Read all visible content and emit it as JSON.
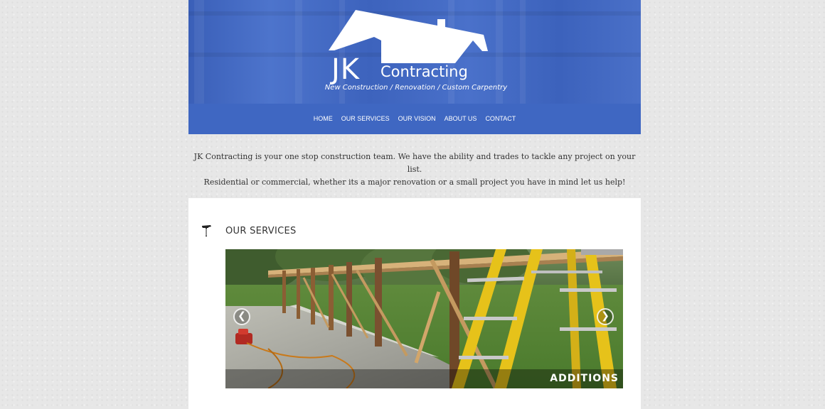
{
  "brand": {
    "logo_initials": "JK",
    "logo_name": "Contracting",
    "tagline": "New Construction / Renovation / Custom Carpentry"
  },
  "nav": {
    "items": [
      {
        "label": "HOME"
      },
      {
        "label": "OUR SERVICES"
      },
      {
        "label": "OUR VISION"
      },
      {
        "label": "ABOUT US"
      },
      {
        "label": "CONTACT"
      }
    ]
  },
  "intro": {
    "line1": "JK Contracting is your one stop construction team. We have the ability and trades to tackle any project on your list.",
    "line2": "Residential or commercial, whether its a major renovation or a small project you have in mind let us help!"
  },
  "services": {
    "title": "OUR SERVICES",
    "slide_caption": "ADDITIONS",
    "prev_arrow": "❮",
    "next_arrow": "❯"
  },
  "colors": {
    "header_blue": "#3f67c2",
    "page_background": "#e7e7e7",
    "card_background": "#ffffff",
    "ladder_yellow": "#e6c21a"
  }
}
